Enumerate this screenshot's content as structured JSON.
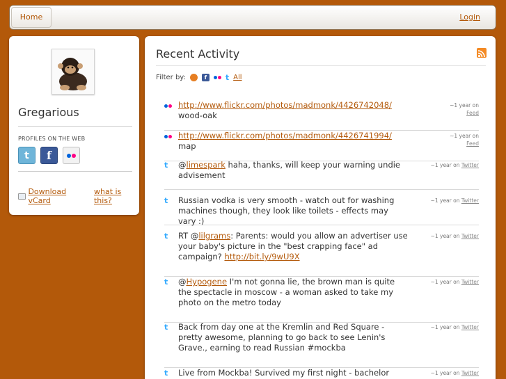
{
  "nav": {
    "home_label": "Home",
    "login_label": "Login"
  },
  "profile": {
    "name": "Gregarious",
    "profiles_label": "PROFILES ON THE WEB",
    "vcard_label": "Download vCard",
    "what_label": "what is this?"
  },
  "activity": {
    "title": "Recent Activity",
    "filter_label": "Filter by:",
    "filter_all": "All",
    "items": [
      {
        "source": "flickr",
        "link": "http://www.flickr.com/photos/madmonk/4426742048/",
        "text": " wood-oak",
        "time": "~1 year on",
        "via": "Feed"
      },
      {
        "source": "flickr",
        "link": "http://www.flickr.com/photos/madmonk/4426741994/",
        "text": " map",
        "time": "~1 year on",
        "via": "Feed"
      },
      {
        "source": "twitter",
        "prefix": "@",
        "mention": "limespark",
        "text": " haha, thanks, will keep your warning undie advisement",
        "time": "~1 year on",
        "via": "Twitter"
      },
      {
        "source": "twitter",
        "text": "Russian vodka is very smooth - watch out for washing machines though, they look like toilets - effects may vary :)",
        "time": "~1 year on",
        "via": "Twitter"
      },
      {
        "source": "twitter",
        "prefix": "RT @",
        "mention": "lilgrams",
        "text": ": Parents: would you allow an advertiser use your baby's picture in the \"best crapping face\" ad campaign? ",
        "link": "http://bit.ly/9wU9X",
        "time": "~1 year on",
        "via": "Twitter"
      },
      {
        "source": "twitter",
        "prefix": "@",
        "mention": "Hypogene",
        "text": " I'm not gonna lie, the brown man is quite the spectacle in moscow - a woman asked to take my photo on the metro today",
        "time": "~1 year on",
        "via": "Twitter"
      },
      {
        "source": "twitter",
        "text": "Back from day one at the Kremlin and Red Square - pretty awesome, planning to go back to see Lenin's Grave., earning to read Russian #mockba",
        "time": "~1 year on",
        "via": "Twitter"
      },
      {
        "source": "twitter",
        "text": "Live from Mockba! Survived my first night - bachelor party and",
        "time": "~1 year on",
        "via": "Twitter"
      }
    ]
  }
}
